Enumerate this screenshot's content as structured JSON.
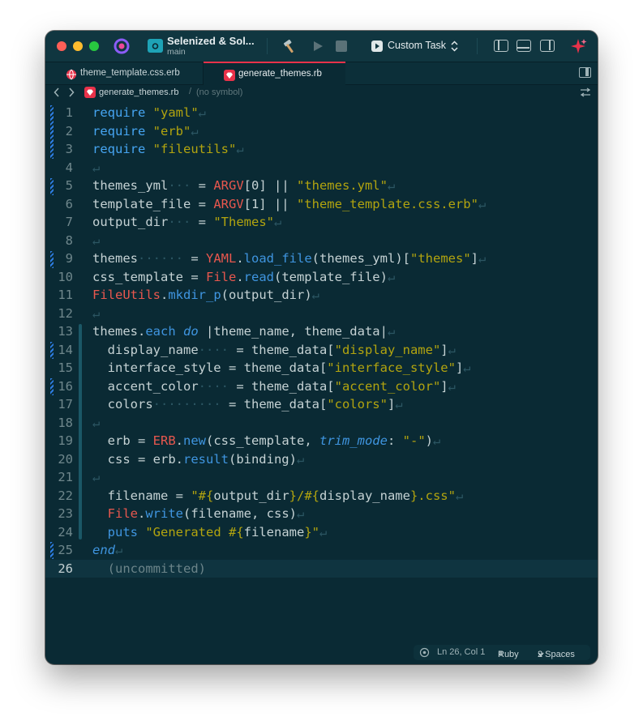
{
  "window": {
    "project_name": "Selenized & Sol...",
    "branch": "main",
    "scheme": "Custom Task",
    "colors": {
      "accent": "#e8324a",
      "editor_bg": "#0a2a34",
      "change_marker": "#2d7de2"
    }
  },
  "icons": [
    "app-logo-icon",
    "folder-gear-icon",
    "hammer-icon",
    "run-icon",
    "stop-icon",
    "play-icon",
    "chevron-updown-icon",
    "sidebar-left-icon",
    "panel-bottom-icon",
    "sidebar-right-icon",
    "sparkle-icon",
    "globe-icon",
    "ruby-icon",
    "chevron-left-icon",
    "chevron-right-icon",
    "inspector-icon",
    "split-arrows-icon",
    "gear-icon"
  ],
  "tabs": [
    {
      "label": "theme_template.css.erb",
      "active": false
    },
    {
      "label": "generate_themes.rb",
      "active": true
    }
  ],
  "jumpbar": {
    "file": "generate_themes.rb",
    "separator": "/",
    "symbol": "(no symbol)"
  },
  "line_numbers": [
    "1",
    "2",
    "3",
    "4",
    "5",
    "6",
    "7",
    "8",
    "9",
    "10",
    "11",
    "12",
    "13",
    "14",
    "15",
    "16",
    "17",
    "18",
    "19",
    "20",
    "21",
    "22",
    "23",
    "24",
    "25",
    "26"
  ],
  "code": {
    "l1": {
      "kw": "require",
      "s": "\"yaml\""
    },
    "l2": {
      "kw": "require",
      "s": "\"erb\""
    },
    "l3": {
      "kw": "require",
      "s": "\"fileutils\""
    },
    "l5": {
      "a": "themes_yml",
      "b": " = ",
      "c": "ARGV",
      "d": "[0] || ",
      "e": "\"themes.yml\""
    },
    "l6": {
      "a": "template_file = ",
      "c": "ARGV",
      "d": "[1] || ",
      "e": "\"theme_template.css.erb\""
    },
    "l7": {
      "a": "output_dir",
      "b": " = ",
      "e": "\"Themes\""
    },
    "l9": {
      "a": "themes",
      "b": " = ",
      "c": "YAML",
      "d": ".",
      "m": "load_file",
      "f": "(themes_yml)[",
      "e": "\"themes\"",
      "g": "]"
    },
    "l10": {
      "a": "css_template = ",
      "c": "File",
      "d": ".",
      "m": "read",
      "f": "(template_file)"
    },
    "l11": {
      "c": "FileUtils",
      "d": ".",
      "m": "mkdir_p",
      "f": "(output_dir)"
    },
    "l13": {
      "a": "themes.",
      "m": "each",
      "it": "do",
      "f": " |theme_name, theme_data|"
    },
    "l14": {
      "a": "  display_name",
      "b": " = theme_data[",
      "e": "\"display_name\"",
      "g": "]"
    },
    "l15": {
      "a": "  interface_style = theme_data[",
      "e": "\"interface_style\"",
      "g": "]"
    },
    "l16": {
      "a": "  accent_color",
      "b": " = theme_data[",
      "e": "\"accent_color\"",
      "g": "]"
    },
    "l17": {
      "a": "  colors",
      "b": " = theme_data[",
      "e": "\"colors\"",
      "g": "]"
    },
    "l19": {
      "a": "  erb = ",
      "c": "ERB",
      "d": ".",
      "m": "new",
      "f": "(css_template, ",
      "it": "trim_mode",
      "h": ": ",
      "e": "\"-\"",
      "g": ")"
    },
    "l20": {
      "a": "  css = erb.",
      "m": "result",
      "f": "(binding)"
    },
    "l22": {
      "a": "  filename = ",
      "e1": "\"#{",
      "v1": "output_dir",
      "e2": "}/#{",
      "v2": "display_name",
      "e3": "}.css\""
    },
    "l23": {
      "c": "  File",
      "d": ".",
      "m": "write",
      "f": "(filename, css)"
    },
    "l24": {
      "m": "  puts",
      "e1": " \"Generated #{",
      "v1": "filename",
      "e3": "}\""
    },
    "l25": {
      "it": "end"
    },
    "l26": {
      "unc": "(uncommitted)"
    }
  },
  "status": {
    "position": "Ln 26, Col 1",
    "language": "Ruby",
    "indent": "2 Spaces"
  }
}
